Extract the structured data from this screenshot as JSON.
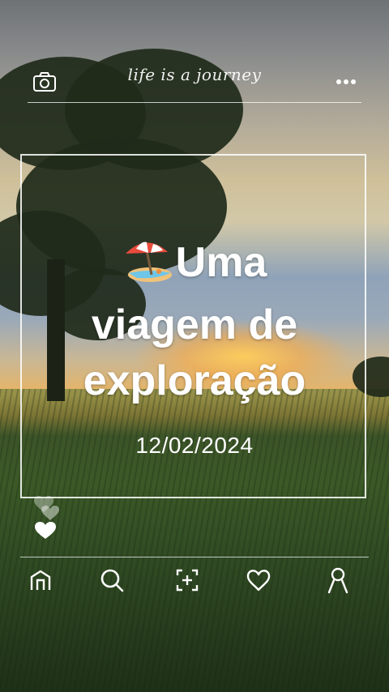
{
  "header": {
    "brand_text": "life is a journey",
    "camera_icon": "camera-icon",
    "menu_icon": "more-dots-icon"
  },
  "card": {
    "title": "Uma viagem de exploração",
    "title_emoji": "beach-umbrella-emoji",
    "date": "12/02/2024"
  },
  "reactions": {
    "icon": "heart-icon"
  },
  "bottom_nav": {
    "items": [
      {
        "name": "home",
        "icon": "home-icon"
      },
      {
        "name": "search",
        "icon": "search-icon"
      },
      {
        "name": "add",
        "icon": "add-photo-icon"
      },
      {
        "name": "likes",
        "icon": "heart-icon"
      },
      {
        "name": "profile",
        "icon": "profile-icon"
      }
    ]
  },
  "colors": {
    "overlay_text": "#ffffff",
    "frame": "#ffffff"
  }
}
